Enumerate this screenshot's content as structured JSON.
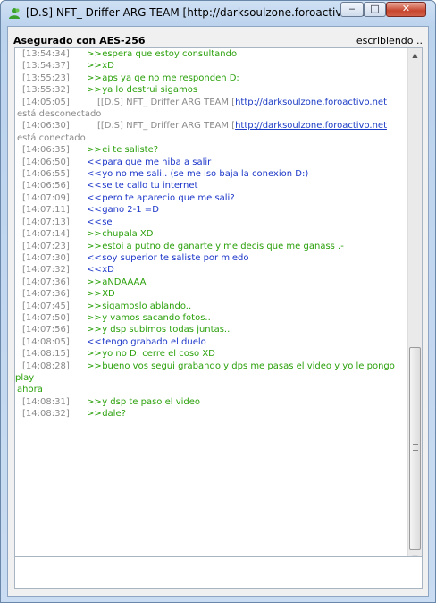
{
  "window": {
    "title": "[D.S] NFT_ Driffer ARG TEAM  [http://darksoulzone.foroactivo.net",
    "controls": {
      "min": "‒",
      "max": "□",
      "close": "✕"
    }
  },
  "status": {
    "left": "Asegurado con AES-256",
    "right": "escribiendo .."
  },
  "messages": [
    {
      "type": "out",
      "ts": "[13:54:34]",
      "dir": ">>",
      "text": "espera que estoy consultando"
    },
    {
      "type": "out",
      "ts": "[13:54:37]",
      "dir": ">>",
      "text": "xD"
    },
    {
      "type": "out",
      "ts": "[13:55:23]",
      "dir": ">>",
      "text": "aps ya qe no me responden D:"
    },
    {
      "type": "out",
      "ts": "[13:55:32]",
      "dir": ">>",
      "text": "ya lo destrui sigamos"
    },
    {
      "type": "sys",
      "ts": "[14:05:05]",
      "text": "[[D.S] NFT_ Driffer ARG TEAM  [",
      "link": "http://darksoulzone.foroactivo.net",
      "after": "está desconectado"
    },
    {
      "type": "sys",
      "ts": "[14:06:30]",
      "text": "[[D.S] NFT_ Driffer ARG TEAM  [",
      "link": "http://darksoulzone.foroactivo.net",
      "after": "está conectado"
    },
    {
      "type": "out",
      "ts": "[14:06:35]",
      "dir": ">>",
      "text": "ei te saliste?"
    },
    {
      "type": "in",
      "ts": "[14:06:50]",
      "dir": "<<",
      "text": "para que me hiba a salir"
    },
    {
      "type": "in",
      "ts": "[14:06:55]",
      "dir": "<<",
      "text": "yo no me sali.. (se me iso baja la conexion D:)"
    },
    {
      "type": "in",
      "ts": "[14:06:56]",
      "dir": "<<",
      "text": "se te callo tu internet"
    },
    {
      "type": "in",
      "ts": "[14:07:09]",
      "dir": "<<",
      "text": "pero te aparecio que me sali?"
    },
    {
      "type": "in",
      "ts": "[14:07:11]",
      "dir": "<<",
      "text": "gano 2-1 =D"
    },
    {
      "type": "in",
      "ts": "[14:07:13]",
      "dir": "<<",
      "text": "se"
    },
    {
      "type": "out",
      "ts": "[14:07:14]",
      "dir": ">>",
      "text": "chupala XD"
    },
    {
      "type": "out",
      "ts": "[14:07:23]",
      "dir": ">>",
      "text": "estoi a putno de ganarte y me decis que me ganass .-"
    },
    {
      "type": "in",
      "ts": "[14:07:30]",
      "dir": "<<",
      "text": "soy superior te saliste por miedo"
    },
    {
      "type": "in",
      "ts": "[14:07:32]",
      "dir": "<<",
      "text": "xD"
    },
    {
      "type": "out",
      "ts": "[14:07:36]",
      "dir": ">>",
      "text": "aNDAAAA"
    },
    {
      "type": "out",
      "ts": "[14:07:36]",
      "dir": ">>",
      "text": "XD"
    },
    {
      "type": "out",
      "ts": "[14:07:45]",
      "dir": ">>",
      "text": "sigamoslo ablando.."
    },
    {
      "type": "out",
      "ts": "[14:07:50]",
      "dir": ">>",
      "text": "y vamos sacando fotos.."
    },
    {
      "type": "out",
      "ts": "[14:07:56]",
      "dir": ">>",
      "text": "y dsp subimos todas juntas.."
    },
    {
      "type": "in",
      "ts": "[14:08:05]",
      "dir": "<<",
      "text": "tengo grabado el duelo"
    },
    {
      "type": "out",
      "ts": "[14:08:15]",
      "dir": ">>",
      "text": "yo no D: cerre el coso XD"
    },
    {
      "type": "out",
      "ts": "[14:08:28]",
      "dir": ">>",
      "text": "bueno vos segui grabando y dps me pasas el video y yo le pongo play",
      "wrap": "ahora"
    },
    {
      "type": "out",
      "ts": "[14:08:31]",
      "dir": ">>",
      "text": "y dsp te paso el video"
    },
    {
      "type": "out",
      "ts": "[14:08:32]",
      "dir": ">>",
      "text": "dale?"
    }
  ],
  "scrollbar": {
    "up": "▲",
    "down": "▼"
  },
  "input": {
    "value": ""
  }
}
